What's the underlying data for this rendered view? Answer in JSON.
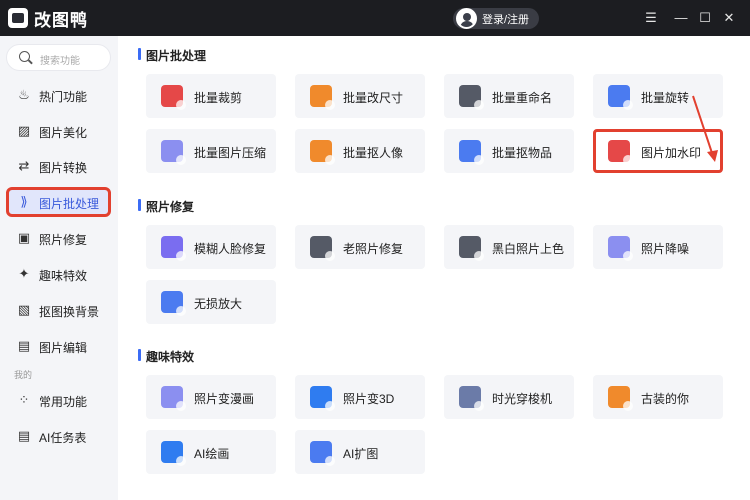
{
  "app": {
    "name": "改图鸭",
    "login_label": "登录/注册"
  },
  "window_controls": {
    "menu": "☰",
    "minimize": "—",
    "maximize": "☐",
    "close": "✕"
  },
  "sidebar": {
    "search_placeholder": "搜索功能",
    "items": [
      {
        "label": "热门功能",
        "icon": "flame-icon",
        "glyph": "♨"
      },
      {
        "label": "图片美化",
        "icon": "image-icon",
        "glyph": "▨"
      },
      {
        "label": "图片转换",
        "icon": "convert-icon",
        "glyph": "⇄"
      },
      {
        "label": "图片批处理",
        "icon": "batch-icon",
        "glyph": "⟫"
      },
      {
        "label": "照片修复",
        "icon": "repair-icon",
        "glyph": "▣"
      },
      {
        "label": "趣味特效",
        "icon": "sparkle-icon",
        "glyph": "✦"
      },
      {
        "label": "抠图换背景",
        "icon": "cutout-icon",
        "glyph": "▧"
      },
      {
        "label": "图片编辑",
        "icon": "edit-icon",
        "glyph": "▤"
      },
      {
        "label": "常用功能",
        "icon": "grid-icon",
        "glyph": "⁘"
      },
      {
        "label": "AI任务表",
        "icon": "list-icon",
        "glyph": "▤"
      }
    ],
    "section_label": "我的",
    "active_index": 3
  },
  "sections": [
    {
      "title": "图片批处理",
      "cards": [
        {
          "label": "批量裁剪",
          "icon": "crop-icon",
          "color": "#e54848"
        },
        {
          "label": "批量改尺寸",
          "icon": "resize-icon",
          "color": "#f08a2c"
        },
        {
          "label": "批量重命名",
          "icon": "rename-icon",
          "color": "#555a66"
        },
        {
          "label": "批量旋转",
          "icon": "rotate-icon",
          "color": "#4b7bf0"
        },
        {
          "label": "批量图片压缩",
          "icon": "compress-icon",
          "color": "#8b8ff0"
        },
        {
          "label": "批量抠人像",
          "icon": "portrait-cutout-icon",
          "color": "#f08a2c"
        },
        {
          "label": "批量抠物品",
          "icon": "object-cutout-icon",
          "color": "#4b7bf0"
        },
        {
          "label": "图片加水印",
          "icon": "watermark-icon",
          "color": "#e54848",
          "highlighted": true
        }
      ]
    },
    {
      "title": "照片修复",
      "cards": [
        {
          "label": "模糊人脸修复",
          "icon": "face-repair-icon",
          "color": "#7a6df0"
        },
        {
          "label": "老照片修复",
          "icon": "old-photo-icon",
          "color": "#555a66"
        },
        {
          "label": "黑白照片上色",
          "icon": "palette-icon",
          "color": "#555a66"
        },
        {
          "label": "照片降噪",
          "icon": "denoise-icon",
          "color": "#8b8ff0"
        },
        {
          "label": "无损放大",
          "icon": "upscale-icon",
          "color": "#4b7bf0"
        }
      ]
    },
    {
      "title": "趣味特效",
      "cards": [
        {
          "label": "照片变漫画",
          "icon": "comic-icon",
          "color": "#8b8ff0"
        },
        {
          "label": "照片变3D",
          "icon": "cube-icon",
          "color": "#2f7cf0"
        },
        {
          "label": "时光穿梭机",
          "icon": "time-machine-icon",
          "color": "#6b7ba8"
        },
        {
          "label": "古装的你",
          "icon": "costume-icon",
          "color": "#f08a2c"
        },
        {
          "label": "AI绘画",
          "icon": "ai-paint-icon",
          "color": "#2f7cf0"
        },
        {
          "label": "AI扩图",
          "icon": "ai-expand-icon",
          "color": "#4b7bf0"
        }
      ]
    }
  ],
  "annotation": {
    "arrow_color": "#e2402f"
  }
}
